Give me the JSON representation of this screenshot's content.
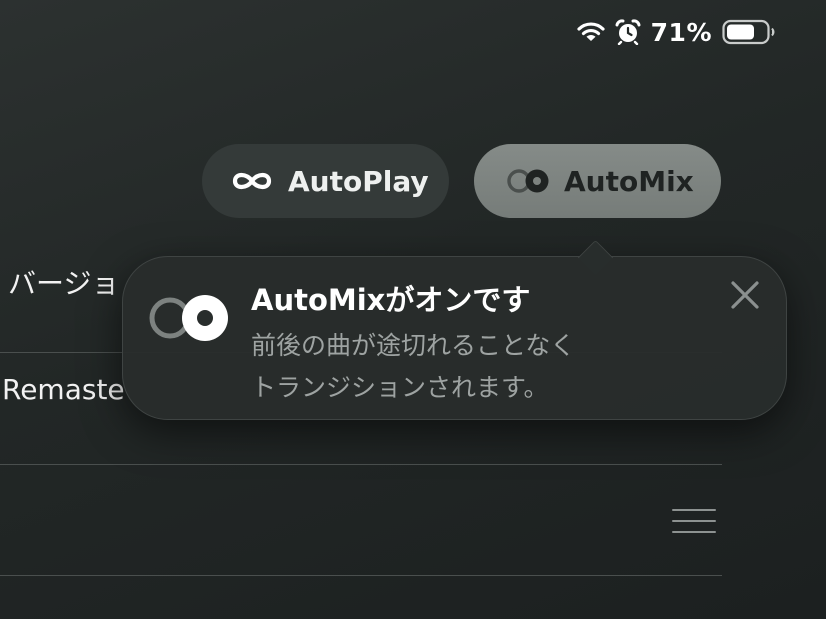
{
  "status_bar": {
    "wifi_icon": "wifi-icon",
    "alarm_icon": "alarm-clock-icon",
    "battery_percent": "71%",
    "battery_level": 0.71
  },
  "mode_pills": {
    "autoplay": {
      "icon": "infinity-icon",
      "label": "AutoPlay",
      "selected": false
    },
    "automix": {
      "icon": "automix-icon",
      "label": "AutoMix",
      "selected": true
    }
  },
  "list": {
    "row_version_text": "バージョ",
    "row_remaster_text": "Remaste"
  },
  "popover": {
    "icon": "automix-icon",
    "title": "AutoMixがオンです",
    "body_line1": "前後の曲が途切れることなく",
    "body_line2": "トランジションされます。",
    "close_icon": "close-icon"
  },
  "colors": {
    "background": "#222726",
    "pill_inactive": "#343a39",
    "pill_active": "#7d8380",
    "popover_bg": "#282d2c",
    "secondary_text": "#9ea3a2"
  }
}
